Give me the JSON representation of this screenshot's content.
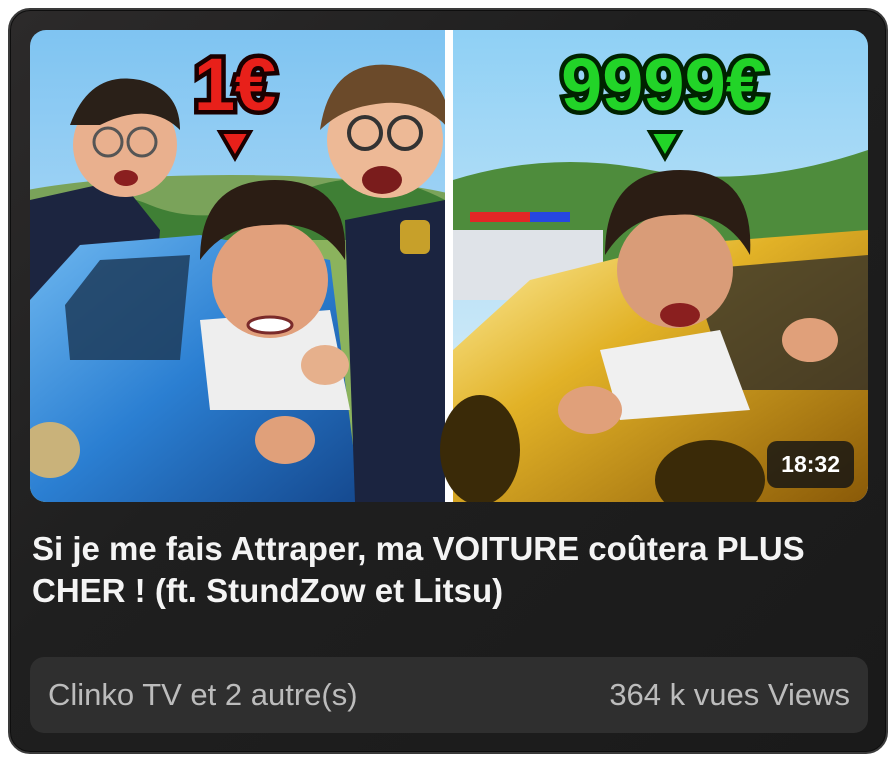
{
  "video": {
    "title": "Si je me fais Attraper, ma VOITURE coûtera PLUS CHER ! (ft. StundZow et Litsu)",
    "duration": "18:32",
    "channel": "Clinko TV et 2 autre(s)",
    "views": "364 k vues Views"
  },
  "thumbnail": {
    "left_price": "1€",
    "right_price": "9999€",
    "left_price_color": "#e8201a",
    "right_price_color": "#22d428",
    "left_car_color": "#2f86d8",
    "right_car_color": "#d9a51c"
  }
}
